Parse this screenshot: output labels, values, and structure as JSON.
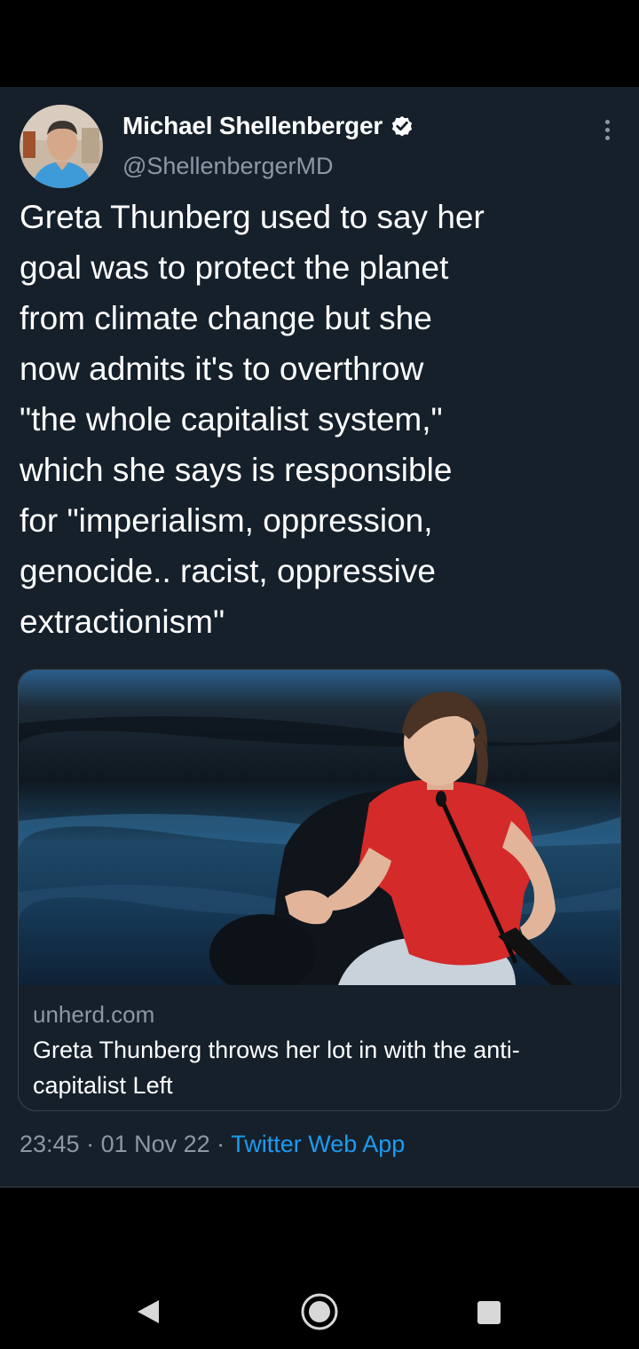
{
  "author": {
    "display_name": "Michael Shellenberger",
    "handle": "@ShellenbergerMD",
    "verified": true
  },
  "tweet": {
    "text": "Greta Thunberg used to say her\ngoal was to protect the planet\nfrom climate change but she\nnow admits it's to overthrow\n\"the whole capitalist system,\"\nwhich she says is responsible\nfor \"imperialism, oppression,\ngenocide.. racist, oppressive\nextractionism\""
  },
  "card": {
    "domain": "unherd.com",
    "title": "Greta Thunberg throws her lot in with the anti-capitalist Left"
  },
  "meta": {
    "time": "23:45",
    "separator1": " · ",
    "date": "01 Nov 22",
    "separator2": " · ",
    "source": "Twitter Web App"
  },
  "icons": {
    "verified": "verified-badge-icon",
    "more": "more-vertical-icon",
    "back": "back-triangle-icon",
    "home": "home-circle-icon",
    "recents": "recents-square-icon"
  },
  "colors": {
    "background": "#15202b",
    "text_primary": "#ffffff",
    "text_secondary": "#8b98a5",
    "accent": "#1d9bf0",
    "border": "#38444d"
  }
}
